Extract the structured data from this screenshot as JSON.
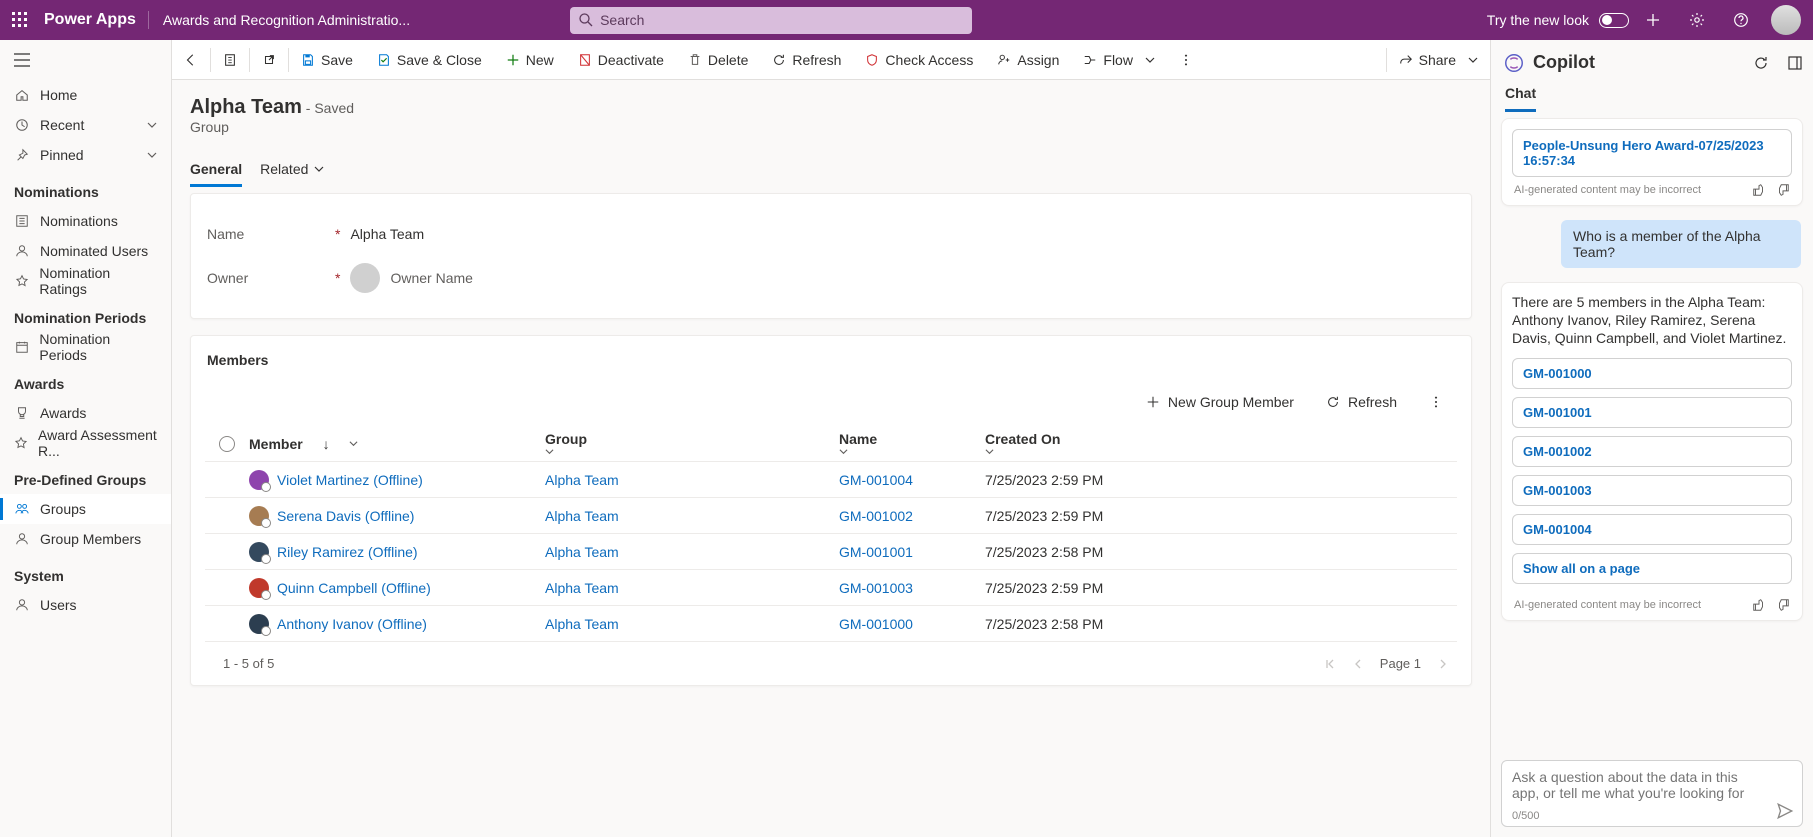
{
  "topbar": {
    "brand": "Power Apps",
    "app_title": "Awards and Recognition Administratio...",
    "search_placeholder": "Search",
    "try_new_look": "Try the new look"
  },
  "leftnav": {
    "home": "Home",
    "recent": "Recent",
    "pinned": "Pinned",
    "groups": {
      "nominations_head": "Nominations",
      "nominations": "Nominations",
      "nominated_users": "Nominated Users",
      "nomination_ratings": "Nomination Ratings",
      "periods_head": "Nomination Periods",
      "nomination_periods": "Nomination Periods",
      "awards_head": "Awards",
      "awards": "Awards",
      "award_assessment": "Award Assessment R...",
      "predef_head": "Pre-Defined Groups",
      "groups_item": "Groups",
      "group_members": "Group Members",
      "system_head": "System",
      "users": "Users"
    }
  },
  "cmd": {
    "save": "Save",
    "save_close": "Save & Close",
    "new": "New",
    "deactivate": "Deactivate",
    "delete": "Delete",
    "refresh": "Refresh",
    "check_access": "Check Access",
    "assign": "Assign",
    "flow": "Flow",
    "share": "Share"
  },
  "record": {
    "title": "Alpha Team",
    "saved": "- Saved",
    "entity": "Group",
    "tab_general": "General",
    "tab_related": "Related",
    "name_label": "Name",
    "name_value": "Alpha Team",
    "owner_label": "Owner",
    "owner_value": "Owner Name"
  },
  "members": {
    "heading": "Members",
    "new_btn": "New Group Member",
    "refresh_btn": "Refresh",
    "col_member": "Member",
    "col_group": "Group",
    "col_name": "Name",
    "col_created": "Created On",
    "rows": [
      {
        "member": "Violet Martinez (Offline)",
        "group": "Alpha Team",
        "name": "GM-001004",
        "created": "7/25/2023 2:59 PM",
        "avatar": "#8e44ad"
      },
      {
        "member": "Serena Davis (Offline)",
        "group": "Alpha Team",
        "name": "GM-001002",
        "created": "7/25/2023 2:59 PM",
        "avatar": "#a67c52"
      },
      {
        "member": "Riley Ramirez (Offline)",
        "group": "Alpha Team",
        "name": "GM-001001",
        "created": "7/25/2023 2:58 PM",
        "avatar": "#34495e"
      },
      {
        "member": "Quinn Campbell (Offline)",
        "group": "Alpha Team",
        "name": "GM-001003",
        "created": "7/25/2023 2:59 PM",
        "avatar": "#c0392b"
      },
      {
        "member": "Anthony Ivanov (Offline)",
        "group": "Alpha Team",
        "name": "GM-001000",
        "created": "7/25/2023 2:58 PM",
        "avatar": "#2c3e50"
      }
    ],
    "footer_count": "1 - 5 of 5",
    "page_label": "Page 1"
  },
  "copilot": {
    "title": "Copilot",
    "tab_chat": "Chat",
    "prev_link": "People-Unsung Hero Award-07/25/2023 16:57:34",
    "disclaimer": "AI-generated content may be incorrect",
    "user_q": "Who is a member of the Alpha Team?",
    "answer": "There are 5 members in the Alpha Team: Anthony Ivanov, Riley Ramirez, Serena Davis, Quinn Campbell, and Violet Martinez.",
    "chips": [
      "GM-001000",
      "GM-001001",
      "GM-001002",
      "GM-001003",
      "GM-001004"
    ],
    "show_all": "Show all on a page",
    "input_placeholder": "Ask a question about the data in this app, or tell me what you're looking for",
    "counter": "0/500"
  }
}
